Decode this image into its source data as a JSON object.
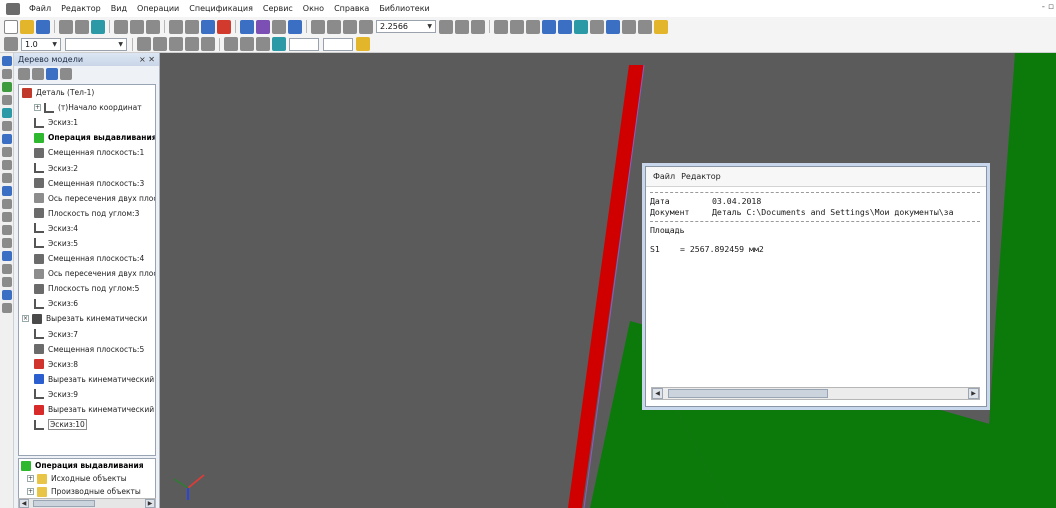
{
  "menu": {
    "items": [
      "Файл",
      "Редактор",
      "Вид",
      "Операции",
      "Спецификация",
      "Сервис",
      "Окно",
      "Справка",
      "Библиотеки"
    ],
    "window_control": "- ▫"
  },
  "toolbar": {
    "zoom_value": "2.2566",
    "scale_value": "1.0",
    "icons": [
      "new-icon",
      "open-icon",
      "save-icon",
      "print-icon",
      "preview-icon",
      "cut-icon",
      "copy-icon",
      "paste-icon",
      "undo-icon",
      "redo-icon",
      "rebuild-icon",
      "function-icon",
      "zoom-icon",
      "pan-icon",
      "rotate-icon",
      "view-orientation-icon",
      "shaded-icon",
      "perspective-icon"
    ]
  },
  "tree_panel": {
    "title": "Дерево модели",
    "close_label": "× ✕",
    "items": [
      {
        "label": "Деталь (Тел-1)",
        "icon": "part-icon",
        "color": "#c0392b",
        "indent": 0,
        "bold": false,
        "expander": "",
        "kind": "icon"
      },
      {
        "label": "(т)Начало координат",
        "icon": "origin-icon",
        "color": "#555555",
        "indent": 1,
        "bold": false,
        "expander": "+",
        "kind": "sketch"
      },
      {
        "label": "Эскиз:1",
        "icon": "sketch-icon",
        "color": "#555555",
        "indent": 1,
        "bold": false,
        "expander": "",
        "kind": "sketch"
      },
      {
        "label": "Операция выдавливания",
        "icon": "extrude-icon",
        "color": "#2db82d",
        "indent": 1,
        "bold": true,
        "expander": "",
        "kind": "icon"
      },
      {
        "label": "Смещенная плоскость:1",
        "icon": "plane-icon",
        "color": "#6b6b6b",
        "indent": 1,
        "bold": false,
        "expander": "",
        "kind": "icon"
      },
      {
        "label": "Эскиз:2",
        "icon": "sketch-icon",
        "color": "#555555",
        "indent": 1,
        "bold": false,
        "expander": "",
        "kind": "sketch"
      },
      {
        "label": "Смещенная плоскость:3",
        "icon": "plane-icon",
        "color": "#6b6b6b",
        "indent": 1,
        "bold": false,
        "expander": "",
        "kind": "icon"
      },
      {
        "label": "Ось пересечения двух плоскостей",
        "icon": "axis-icon",
        "color": "#8d8d8d",
        "indent": 1,
        "bold": false,
        "expander": "",
        "kind": "icon"
      },
      {
        "label": "Плоскость под углом:3",
        "icon": "plane-icon",
        "color": "#6b6b6b",
        "indent": 1,
        "bold": false,
        "expander": "",
        "kind": "icon"
      },
      {
        "label": "Эскиз:4",
        "icon": "sketch-icon",
        "color": "#555555",
        "indent": 1,
        "bold": false,
        "expander": "",
        "kind": "sketch"
      },
      {
        "label": "Эскиз:5",
        "icon": "sketch-icon",
        "color": "#555555",
        "indent": 1,
        "bold": false,
        "expander": "",
        "kind": "sketch"
      },
      {
        "label": "Смещенная плоскость:4",
        "icon": "plane-icon",
        "color": "#6b6b6b",
        "indent": 1,
        "bold": false,
        "expander": "",
        "kind": "icon"
      },
      {
        "label": "Ось пересечения двух плоскостей",
        "icon": "axis-icon",
        "color": "#8d8d8d",
        "indent": 1,
        "bold": false,
        "expander": "",
        "kind": "icon"
      },
      {
        "label": "Плоскость под углом:5",
        "icon": "plane-icon",
        "color": "#6b6b6b",
        "indent": 1,
        "bold": false,
        "expander": "",
        "kind": "icon"
      },
      {
        "label": "Эскиз:6",
        "icon": "sketch-icon",
        "color": "#555555",
        "indent": 1,
        "bold": false,
        "expander": "",
        "kind": "sketch"
      },
      {
        "label": "Вырезать кинематически",
        "icon": "cut-sweep-icon",
        "color": "#4a4a4a",
        "indent": 0,
        "bold": false,
        "expander": "×",
        "kind": "icon"
      },
      {
        "label": "Эскиз:7",
        "icon": "sketch-icon",
        "color": "#555555",
        "indent": 1,
        "bold": false,
        "expander": "",
        "kind": "sketch"
      },
      {
        "label": "Смещенная плоскость:5",
        "icon": "plane-icon",
        "color": "#6b6b6b",
        "indent": 1,
        "bold": false,
        "expander": "",
        "kind": "icon"
      },
      {
        "label": "Эскиз:8",
        "icon": "sketch-error-icon",
        "color": "#d0342c",
        "indent": 1,
        "bold": false,
        "expander": "",
        "kind": "icon"
      },
      {
        "label": "Вырезать кинематический",
        "icon": "cut-sweep-icon",
        "color": "#2b5fcf",
        "indent": 1,
        "bold": false,
        "expander": "",
        "kind": "icon"
      },
      {
        "label": "Эскиз:9",
        "icon": "sketch-icon",
        "color": "#555555",
        "indent": 1,
        "bold": false,
        "expander": "",
        "kind": "sketch"
      },
      {
        "label": "Вырезать кинематический",
        "icon": "cut-sweep-icon",
        "color": "#d92a2a",
        "indent": 1,
        "bold": false,
        "expander": "",
        "kind": "icon"
      },
      {
        "label": "Эскиз:10",
        "icon": "sketch-icon",
        "color": "#555555",
        "indent": 1,
        "bold": false,
        "expander": "",
        "kind": "sketch",
        "selected": true
      }
    ],
    "bottom_items": [
      {
        "label": "Операция выдавливания",
        "icon": "extrude-icon",
        "color": "#2db82d",
        "bold": true,
        "expander": ""
      },
      {
        "label": "Исходные объекты",
        "icon": "folder-icon",
        "color": "#e8c547",
        "bold": false,
        "expander": "+"
      },
      {
        "label": "Производные объекты",
        "icon": "folder-icon",
        "color": "#e8c547",
        "bold": false,
        "expander": "+"
      }
    ]
  },
  "scene": {
    "background_color": "#5b5b5b",
    "body_color": "#0b7a0b",
    "edge_color": "#d00000",
    "axis_x_color": "#e53935",
    "axis_y_color": "#2e7d32",
    "axis_z_color": "#1e40ff"
  },
  "result_window": {
    "menu": [
      "Файл",
      "Редактор"
    ],
    "date_label": "Дата",
    "date_value": "03.04.2018",
    "document_label": "Документ",
    "document_value": "Деталь C:\\Documents and Settings\\Мои документы\\за",
    "section_label": "Площадь",
    "area_var": "S1",
    "area_value": "= 2567.892459 мм2"
  }
}
